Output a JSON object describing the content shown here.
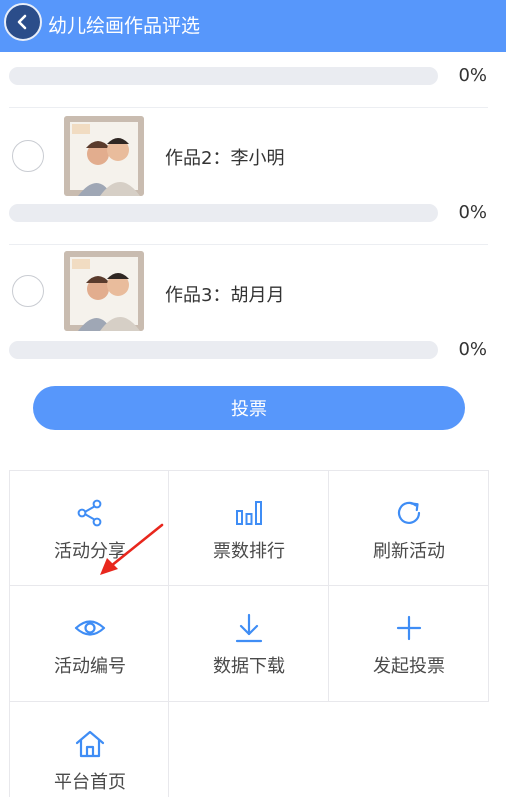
{
  "header": {
    "title": "幼儿绘画作品评选"
  },
  "items": [
    {
      "title": "",
      "percent": "0%",
      "progress": 0
    },
    {
      "title": "作品2：李小明",
      "percent": "0%",
      "progress": 0
    },
    {
      "title": "作品3：胡月月",
      "percent": "0%",
      "progress": 0
    }
  ],
  "vote_button": {
    "label": "投票"
  },
  "menu": [
    {
      "label": "活动分享",
      "icon": "share-icon"
    },
    {
      "label": "票数排行",
      "icon": "bar-chart-icon"
    },
    {
      "label": "刷新活动",
      "icon": "refresh-icon"
    },
    {
      "label": "活动编号",
      "icon": "eye-icon"
    },
    {
      "label": "数据下载",
      "icon": "download-icon"
    },
    {
      "label": "发起投票",
      "icon": "plus-icon"
    },
    {
      "label": "平台首页",
      "icon": "home-icon"
    }
  ],
  "colors": {
    "accent": "#5797fb",
    "icon_blue": "#3f8df5",
    "annotation_red": "#e8271d"
  }
}
